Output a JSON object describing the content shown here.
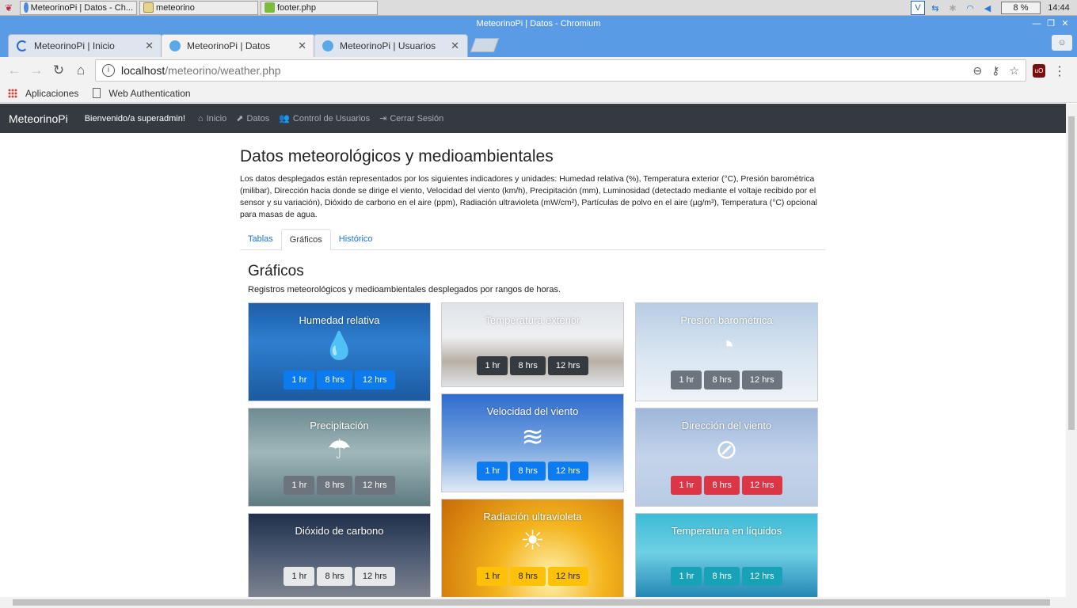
{
  "taskbar": {
    "tasks": [
      "MeteorinoPi | Datos - Ch...",
      "meteorino",
      "footer.php"
    ],
    "cpu": "8 %",
    "clock": "14:44"
  },
  "browser": {
    "window_title": "MeteorinoPi | Datos - Chromium",
    "tabs": [
      {
        "label": "MeteorinoPi | Inicio"
      },
      {
        "label": "MeteorinoPi | Datos"
      },
      {
        "label": "MeteorinoPi | Usuarios"
      }
    ],
    "url_host": "localhost",
    "url_path": "/meteorino/weather.php",
    "bookmarks": [
      "Aplicaciones",
      "Web Authentication"
    ]
  },
  "navbar": {
    "brand": "MeteorinoPi",
    "welcome": "Bienvenido/a superadmin!",
    "links": [
      "Inicio",
      "Datos",
      "Control de Usuarios",
      "Cerrar Sesión"
    ]
  },
  "main": {
    "title": "Datos meteorológicos y medioambientales",
    "intro": "Los datos desplegados están representados por los siguientes indicadores y unidades: Humedad relativa (%), Temperatura exterior (°C), Presión barométrica (milibar), Dirección hacia donde se dirige el viento, Velocidad del viento (km/h), Precipitación (mm), Luminosidad (detectado mediante el voltaje recibido por el sensor y su variación), Dióxido de carbono en el aire (ppm), Radiación ultravioleta (mW/cm²), Partículas de polvo en el aire (µg/m³), Temperatura (°C) opcional para masas de agua.",
    "tabs": [
      "Tablas",
      "Gráficos",
      "Histórico"
    ],
    "section_title": "Gráficos",
    "section_desc": "Registros meteorológicos y medioambientales desplegados por rangos de horas.",
    "buttons": [
      "1 hr",
      "8 hrs",
      "12 hrs"
    ],
    "cards": [
      {
        "title": "Humedad relativa",
        "icon": "water-drop-icon",
        "accent": "#0d7bf0"
      },
      {
        "title": "Temperatura exterior",
        "icon": "none",
        "accent": "#343a40"
      },
      {
        "title": "Presión barométrica",
        "icon": "gauge-icon",
        "accent": "#6c757d"
      },
      {
        "title": "Precipitación",
        "icon": "umbrella-icon",
        "accent": "#6c757d"
      },
      {
        "title": "Velocidad del viento",
        "icon": "wind-icon",
        "accent": "#0d7bf0"
      },
      {
        "title": "Dirección del viento",
        "icon": "compass-icon",
        "accent": "#dc3545"
      },
      {
        "title": "Dióxido de carbono",
        "icon": "none",
        "accent": "#e6e8ea"
      },
      {
        "title": "Radiación ultravioleta",
        "icon": "sun-icon",
        "accent": "#ffc107"
      },
      {
        "title": "Temperatura en líquidos",
        "icon": "none",
        "accent": "#17a2b8"
      }
    ]
  }
}
